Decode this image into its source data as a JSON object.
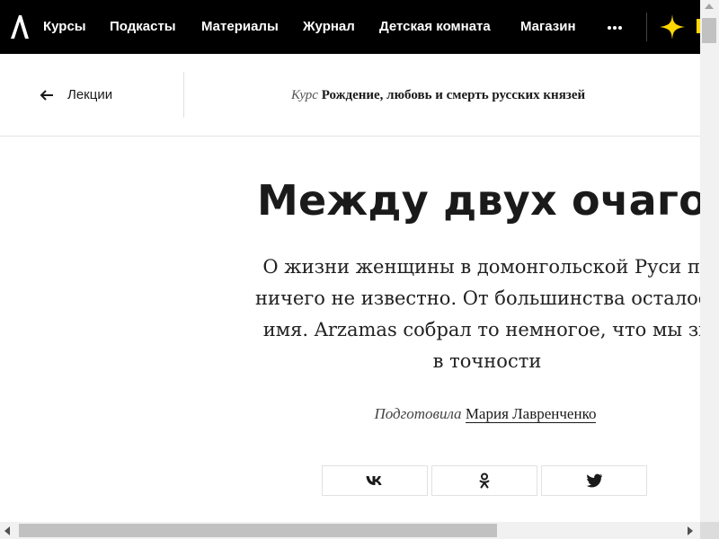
{
  "nav": {
    "items": [
      "Курсы",
      "Подкасты",
      "Материалы",
      "Журнал",
      "Детская комната",
      "Магазин"
    ],
    "more": "more-icon"
  },
  "subheader": {
    "back_label": "Лекции",
    "course_kicker": "Курс",
    "course_title": "Рождение, любовь и смерть русских князей"
  },
  "article": {
    "title": "Между двух очагов",
    "lead_lines": [
      "О жизни женщины в домонгольской Руси по",
      "ничего не известно. От большинства осталось",
      "имя. Arzamas собрал то немногое, что мы зн",
      "в точности"
    ],
    "byline_prefix": "Подготовила",
    "author": "Мария Лавренченко"
  },
  "share": [
    "vk-icon",
    "odnoklassniki-icon",
    "twitter-icon"
  ],
  "colors": {
    "nav_bg": "#000000",
    "accent": "#ffd700",
    "text": "#1a1a1a",
    "border": "#e1e1e1"
  }
}
